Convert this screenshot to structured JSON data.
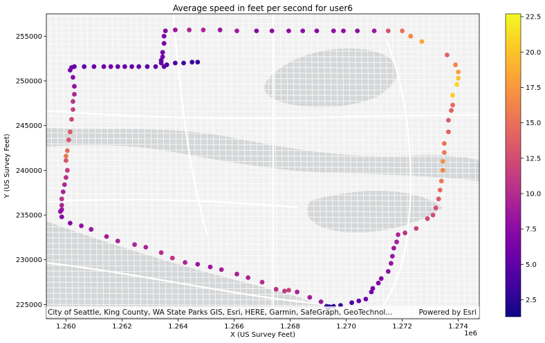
{
  "chart_data": {
    "type": "scatter",
    "title": "Average speed in feet per second for user6",
    "xlabel": "X (US Survey Feet)",
    "ylabel": "Y (US Survey Feet)",
    "x_offset_label": "1e6",
    "xlim": [
      1259300,
      1274750
    ],
    "ylim": [
      223400,
      257500
    ],
    "x_ticks": [
      1260000,
      1262000,
      1264000,
      1266000,
      1268000,
      1270000,
      1272000,
      1274000
    ],
    "x_tick_labels": [
      "1.260",
      "1.262",
      "1.264",
      "1.266",
      "1.268",
      "1.270",
      "1.272",
      "1.274"
    ],
    "y_ticks": [
      225000,
      230000,
      235000,
      240000,
      245000,
      250000,
      255000
    ],
    "y_tick_labels": [
      "225000",
      "230000",
      "235000",
      "240000",
      "245000",
      "250000",
      "255000"
    ],
    "colorbar": {
      "colormap": "plasma",
      "range": [
        1.3,
        22.7
      ],
      "ticks": [
        2.5,
        5.0,
        7.5,
        10.0,
        12.5,
        15.0,
        17.5,
        20.0,
        22.5
      ],
      "tick_labels": [
        "2.5",
        "5.0",
        "7.5",
        "10.0",
        "12.5",
        "15.0",
        "17.5",
        "20.0",
        "22.5"
      ]
    },
    "basemap_attribution": "City of Seattle, King County, WA State Parks GIS, Esri, HERE, Garmin, SafeGraph, GeoTechnol...",
    "basemap_credit": "Powered by Esri",
    "grid": false,
    "points": [
      [
        1264700,
        252100,
        3.0
      ],
      [
        1264500,
        252100,
        3.3
      ],
      [
        1264200,
        252000,
        3.6
      ],
      [
        1263900,
        252000,
        4.0
      ],
      [
        1263600,
        251800,
        4.2
      ],
      [
        1263500,
        251600,
        4.8
      ],
      [
        1263200,
        251600,
        5.0
      ],
      [
        1262900,
        251600,
        5.0
      ],
      [
        1262600,
        251600,
        5.2
      ],
      [
        1262350,
        251600,
        5.2
      ],
      [
        1262100,
        251600,
        5.3
      ],
      [
        1261850,
        251600,
        5.5
      ],
      [
        1261600,
        251600,
        5.8
      ],
      [
        1261350,
        251600,
        5.6
      ],
      [
        1261000,
        251600,
        5.4
      ],
      [
        1260650,
        251600,
        5.1
      ],
      [
        1260300,
        251600,
        5.1
      ],
      [
        1260200,
        251500,
        5.5
      ],
      [
        1260150,
        251200,
        6.5
      ],
      [
        1260250,
        250400,
        7.5
      ],
      [
        1260300,
        249400,
        8.0
      ],
      [
        1260300,
        248500,
        9.5
      ],
      [
        1260250,
        247700,
        10.5
      ],
      [
        1260250,
        246800,
        11.5
      ],
      [
        1260200,
        245700,
        12.0
      ],
      [
        1260150,
        244300,
        13.5
      ],
      [
        1260100,
        243400,
        13.0
      ],
      [
        1260050,
        242200,
        14.5
      ],
      [
        1260000,
        241600,
        15.5
      ],
      [
        1260000,
        241100,
        13.0
      ],
      [
        1260050,
        240000,
        11.0
      ],
      [
        1260000,
        239200,
        10.5
      ],
      [
        1259950,
        238400,
        9.5
      ],
      [
        1259900,
        237600,
        9.0
      ],
      [
        1259850,
        236800,
        10.5
      ],
      [
        1259850,
        236100,
        9.5
      ],
      [
        1259850,
        235600,
        8.5
      ],
      [
        1259800,
        235400,
        7.8
      ],
      [
        1259850,
        234800,
        7.0
      ],
      [
        1260150,
        234100,
        7.2
      ],
      [
        1260550,
        233800,
        8.0
      ],
      [
        1260900,
        233400,
        8.5
      ],
      [
        1261450,
        232600,
        9.0
      ],
      [
        1261850,
        232100,
        9.2
      ],
      [
        1262450,
        231700,
        9.8
      ],
      [
        1262850,
        231400,
        9.5
      ],
      [
        1263400,
        230800,
        10.2
      ],
      [
        1263800,
        230200,
        10.5
      ],
      [
        1264250,
        229700,
        9.5
      ],
      [
        1264700,
        229500,
        8.5
      ],
      [
        1265150,
        229200,
        8.5
      ],
      [
        1265550,
        228900,
        9.0
      ],
      [
        1266100,
        228400,
        9.2
      ],
      [
        1266500,
        228000,
        9.5
      ],
      [
        1267000,
        227500,
        10.0
      ],
      [
        1267500,
        226700,
        10.5
      ],
      [
        1267800,
        226500,
        11.0
      ],
      [
        1267950,
        226600,
        11.5
      ],
      [
        1268250,
        226400,
        9.5
      ],
      [
        1268700,
        225800,
        9.0
      ],
      [
        1269100,
        225300,
        8.5
      ],
      [
        1269300,
        224800,
        3.0
      ],
      [
        1269350,
        224600,
        2.2
      ],
      [
        1269400,
        224750,
        2.0
      ],
      [
        1269550,
        224800,
        2.6
      ],
      [
        1269800,
        224900,
        3.2
      ],
      [
        1270200,
        225200,
        4.5
      ],
      [
        1270450,
        225400,
        5.2
      ],
      [
        1270700,
        225600,
        5.7
      ],
      [
        1270900,
        226400,
        6.0
      ],
      [
        1270950,
        226800,
        6.3
      ],
      [
        1271150,
        227400,
        6.8
      ],
      [
        1271250,
        227900,
        7.0
      ],
      [
        1271500,
        228700,
        7.5
      ],
      [
        1271600,
        229600,
        8.2
      ],
      [
        1271650,
        230400,
        8.3
      ],
      [
        1271700,
        231300,
        8.7
      ],
      [
        1271800,
        232000,
        9.0
      ],
      [
        1271850,
        232800,
        9.5
      ],
      [
        1272100,
        233000,
        10.5
      ],
      [
        1272500,
        233500,
        11.5
      ],
      [
        1272900,
        234600,
        12.0
      ],
      [
        1273100,
        235000,
        12.5
      ],
      [
        1273200,
        235800,
        12.8
      ],
      [
        1273300,
        236800,
        13.5
      ],
      [
        1273350,
        237800,
        14.5
      ],
      [
        1273400,
        238800,
        15.5
      ],
      [
        1273450,
        240000,
        16.5
      ],
      [
        1273450,
        241000,
        17.0
      ],
      [
        1273500,
        242000,
        15.5
      ],
      [
        1273500,
        243000,
        15.0
      ],
      [
        1273650,
        244300,
        14.0
      ],
      [
        1273650,
        245600,
        13.5
      ],
      [
        1273750,
        246700,
        14.0
      ],
      [
        1273800,
        247300,
        14.5
      ],
      [
        1273800,
        248400,
        20.5
      ],
      [
        1273950,
        249600,
        21.0
      ],
      [
        1274000,
        250300,
        20.0
      ],
      [
        1274000,
        251000,
        18.0
      ],
      [
        1273900,
        251800,
        16.5
      ],
      [
        1273600,
        252900,
        14.0
      ],
      [
        1272700,
        254400,
        18.5
      ],
      [
        1272300,
        255000,
        16.5
      ],
      [
        1272000,
        255600,
        15.0
      ],
      [
        1271500,
        255600,
        13.0
      ],
      [
        1271000,
        255600,
        8.5
      ],
      [
        1270400,
        255600,
        7.8
      ],
      [
        1269900,
        255600,
        7.8
      ],
      [
        1269550,
        255600,
        7.8
      ],
      [
        1268950,
        255600,
        7.5
      ],
      [
        1268450,
        255600,
        7.5
      ],
      [
        1267950,
        255600,
        7.8
      ],
      [
        1267350,
        255600,
        7.5
      ],
      [
        1266800,
        255600,
        7.2
      ],
      [
        1266100,
        255600,
        8.8
      ],
      [
        1265500,
        255700,
        8.5
      ],
      [
        1264900,
        255700,
        9.5
      ],
      [
        1264400,
        255700,
        9.5
      ],
      [
        1263900,
        255700,
        8.5
      ],
      [
        1263550,
        255600,
        7.0
      ],
      [
        1263500,
        255000,
        6.5
      ],
      [
        1263500,
        254200,
        6.5
      ],
      [
        1263450,
        253200,
        6.0
      ],
      [
        1263450,
        252700,
        5.8
      ],
      [
        1263400,
        252300,
        5.5
      ],
      [
        1263400,
        252000,
        5.2
      ]
    ]
  }
}
